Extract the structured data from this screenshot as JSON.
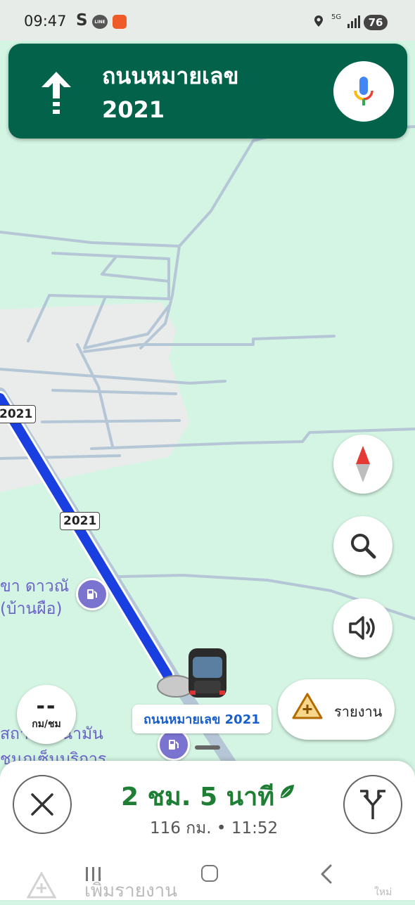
{
  "status_bar": {
    "time": "09:47",
    "s_label": "S",
    "line_label": "LINE",
    "network": "5G",
    "battery": "76"
  },
  "banner": {
    "street_line1": "ถนนหมายเลข",
    "street_line2": "2021"
  },
  "map": {
    "shields": [
      "2021",
      "2021"
    ],
    "poi_labels": [
      "ขา ดาวณั",
      "(บ้านผือ)",
      "สถา  การน้ำมัน",
      "ชุมภูเซ็นบริการ"
    ],
    "road_label": "ถนนหมายเลข 2021"
  },
  "speed": {
    "value": "--",
    "unit": "กม/ชม"
  },
  "report": {
    "label": "รายงาน"
  },
  "trip": {
    "duration": "2 ชม. 5 นาที",
    "distance": "116 กม.",
    "separator": "•",
    "arrival": "11:52"
  },
  "ghost": {
    "text": "เพิ่มรายงาน",
    "new": "ใหม่"
  },
  "colors": {
    "banner": "#02634a",
    "route": "#1a3fe0",
    "eta": "#1e7e34",
    "map_bg": "#d4f5e3"
  }
}
